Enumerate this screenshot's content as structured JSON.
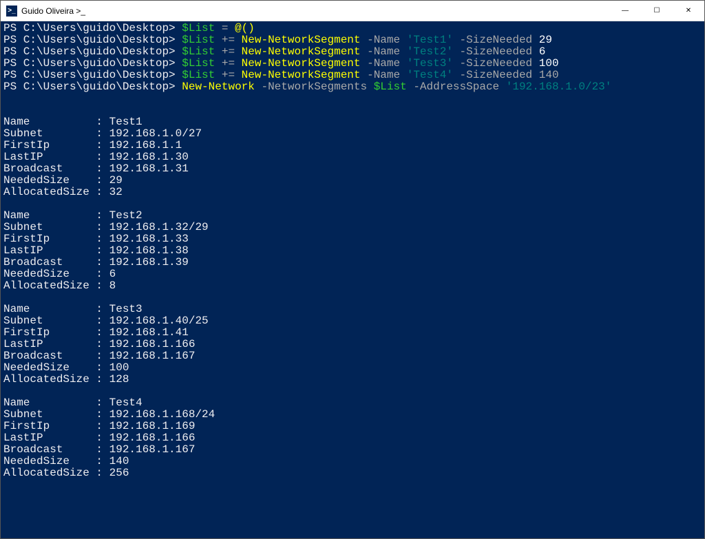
{
  "window": {
    "title": "Guido Oliveira >_",
    "icon_label": ">_",
    "min_label": "—",
    "max_label": "☐",
    "close_label": "✕"
  },
  "prompt": "PS C:\\Users\\guido\\Desktop> ",
  "lines": {
    "l1": {
      "var": "$List",
      "eq": " = ",
      "arr": "@()"
    },
    "l2": {
      "var": "$List",
      "op": " += ",
      "cmd": "New-NetworkSegment",
      "p1": " -Name ",
      "s1": "'Test1'",
      "p2": " -SizeNeeded ",
      "n": "29"
    },
    "l3": {
      "var": "$List",
      "op": " += ",
      "cmd": "New-NetworkSegment",
      "p1": " -Name ",
      "s1": "'Test2'",
      "p2": " -SizeNeeded ",
      "n": "6"
    },
    "l4": {
      "var": "$List",
      "op": " += ",
      "cmd": "New-NetworkSegment",
      "p1": " -Name ",
      "s1": "'Test3'",
      "p2": " -SizeNeeded ",
      "n": "100"
    },
    "l5": {
      "var": "$List",
      "op": " += ",
      "cmd": "New-NetworkSegment",
      "p1": " -Name ",
      "s1": "'Test4'",
      "p2": " -SizeNeeded ",
      "n": "140"
    },
    "l6": {
      "cmd": "New-Network",
      "p1": " -NetworkSegments ",
      "var": "$List",
      "p2": " -AddressSpace ",
      "s1": "'192.168.1.0/23'"
    }
  },
  "output": [
    {
      "Name": "Test1",
      "Subnet": "192.168.1.0/27",
      "FirstIp": "192.168.1.1",
      "LastIP": "192.168.1.30",
      "Broadcast": "192.168.1.31",
      "NeededSize": "29",
      "AllocatedSize": "32"
    },
    {
      "Name": "Test2",
      "Subnet": "192.168.1.32/29",
      "FirstIp": "192.168.1.33",
      "LastIP": "192.168.1.38",
      "Broadcast": "192.168.1.39",
      "NeededSize": "6",
      "AllocatedSize": "8"
    },
    {
      "Name": "Test3",
      "Subnet": "192.168.1.40/25",
      "FirstIp": "192.168.1.41",
      "LastIP": "192.168.1.166",
      "Broadcast": "192.168.1.167",
      "NeededSize": "100",
      "AllocatedSize": "128"
    },
    {
      "Name": "Test4",
      "Subnet": "192.168.1.168/24",
      "FirstIp": "192.168.1.169",
      "LastIP": "192.168.1.166",
      "Broadcast": "192.168.1.167",
      "NeededSize": "140",
      "AllocatedSize": "256"
    }
  ],
  "labels": {
    "Name": "Name",
    "Subnet": "Subnet",
    "FirstIp": "FirstIp",
    "LastIP": "LastIP",
    "Broadcast": "Broadcast",
    "NeededSize": "NeededSize",
    "AllocatedSize": "AllocatedSize"
  }
}
